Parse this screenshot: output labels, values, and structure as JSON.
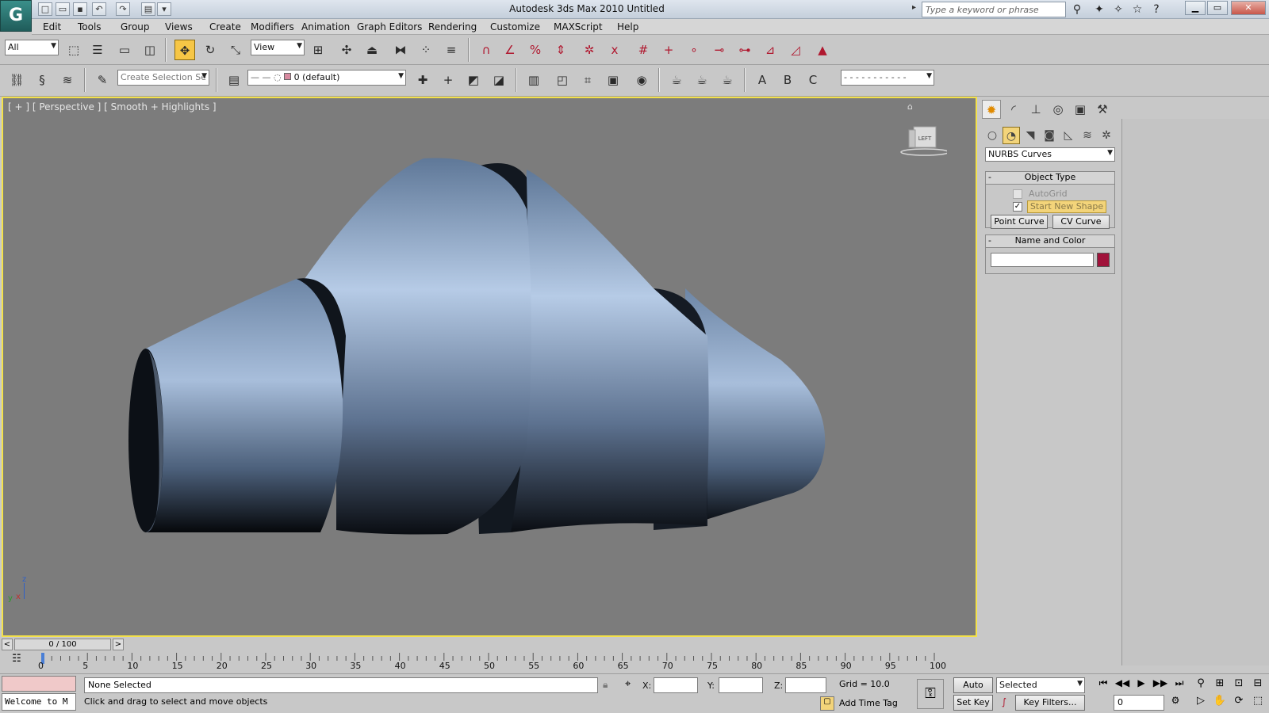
{
  "window": {
    "title": "Autodesk 3ds Max  2010     Untitled",
    "search_placeholder": "Type a keyword or phrase",
    "logo": "G"
  },
  "menu": [
    "Edit",
    "Tools",
    "Group",
    "Views",
    "Create",
    "Modifiers",
    "Animation",
    "Graph Editors",
    "Rendering",
    "Customize",
    "MAXScript",
    "Help"
  ],
  "toolbar": {
    "filter_value": "All",
    "ref_coord_value": "View",
    "selection_set_placeholder": "Create Selection Se",
    "layer_value": "0 (default)"
  },
  "viewport": {
    "label": "[ + ] [ Perspective ] [ Smooth + Highlights ]",
    "viewcube_face": "LEFT",
    "axis_z": "z",
    "axis_x": "x",
    "axis_y": "y",
    "colors": {
      "background": "#7c7c7c",
      "surface": "#8fa6c4",
      "highlight": "#c4d8f0",
      "shadow": "#0e1218",
      "border": "#f3e14a"
    }
  },
  "command_panel": {
    "category_value": "NURBS Curves",
    "object_type": {
      "title": "Object Type",
      "autogrid_label": "AutoGrid",
      "start_new_shape_label": "Start New Shape",
      "point_curve_label": "Point Curve",
      "cv_curve_label": "CV Curve"
    },
    "name_color": {
      "title": "Name and Color",
      "name_value": "",
      "swatch_color": "#a0123a"
    }
  },
  "timeline": {
    "frame_display": "0 / 100",
    "prev_label": "<",
    "next_label": ">",
    "ticks": [
      "0",
      "5",
      "10",
      "15",
      "20",
      "25",
      "30",
      "35",
      "40",
      "45",
      "50",
      "55",
      "60",
      "65",
      "70",
      "75",
      "80",
      "85",
      "90",
      "95",
      "100"
    ]
  },
  "status": {
    "listener_text": "Welcome to M",
    "selection_status": "None Selected",
    "prompt": "Click and drag to select and move objects",
    "x_label": "X:",
    "y_label": "Y:",
    "z_label": "Z:",
    "grid_text": "Grid = 10.0",
    "add_time_tag": "Add Time Tag",
    "auto_key": "Auto Key",
    "set_key": "Set Key",
    "key_mode_value": "Selected",
    "key_filters": "Key Filters...",
    "frame_value": "0"
  }
}
